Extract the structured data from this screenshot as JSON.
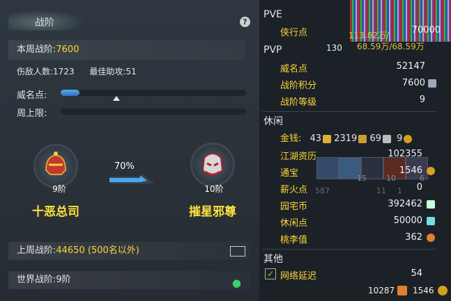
{
  "left": {
    "title": "战阶",
    "help_glyph": "?",
    "week_rank_label": "本周战阶:",
    "week_rank_value": "7600",
    "injured_label": "伤敌人数:",
    "injured_value": "1723",
    "best_assist_label": "最佳助攻:",
    "best_assist_value": "51",
    "fame_label": "威名点:",
    "fame_progress": 0.1,
    "weekly_cap_label": "周上限:",
    "weekly_cap_progress": 0.0,
    "current_rank": {
      "level": "9阶",
      "name": "十恶总司"
    },
    "next_rank": {
      "level": "10阶",
      "name": "摧星邪尊"
    },
    "progress_pct": "70%",
    "last_week_label": "上周战阶:",
    "last_week_value": "44650 (500名以外)",
    "world_rank_label": "世界战阶:",
    "world_rank_value": "9阶"
  },
  "right": {
    "pve": {
      "header": "PVE",
      "items": [
        {
          "label": "侠行点",
          "value": "70000"
        }
      ],
      "overlay_text": [
        "113.82万/",
        "68.59万/68.59万",
        "130"
      ]
    },
    "pvp": {
      "header": "PVP",
      "items": [
        {
          "label": "威名点",
          "value": "52147"
        },
        {
          "label": "战阶积分",
          "value": "7600"
        },
        {
          "label": "战阶等级",
          "value": "9"
        }
      ]
    },
    "leisure": {
      "header": "休闲",
      "money_label": "金钱:",
      "money": [
        "43",
        "2319",
        "69",
        "9"
      ],
      "items": [
        {
          "label": "江湖资历",
          "value": "102355"
        },
        {
          "label": "通宝",
          "value": "1546"
        },
        {
          "label": "薪火点",
          "value": "0"
        },
        {
          "label": "园宅币",
          "value": "392462"
        },
        {
          "label": "休闲点",
          "value": "50000"
        },
        {
          "label": "桃李值",
          "value": "362"
        }
      ],
      "overlay_nums": [
        "15",
        "10",
        "6",
        "587",
        "11",
        "1"
      ]
    },
    "other": {
      "header": "其他",
      "latency_label": "网络延迟",
      "latency_value": "54"
    },
    "footer": {
      "left": "10287",
      "right": "1546"
    },
    "colors": {
      "gold": "#ffd53a",
      "check": "#5fd66e"
    }
  }
}
